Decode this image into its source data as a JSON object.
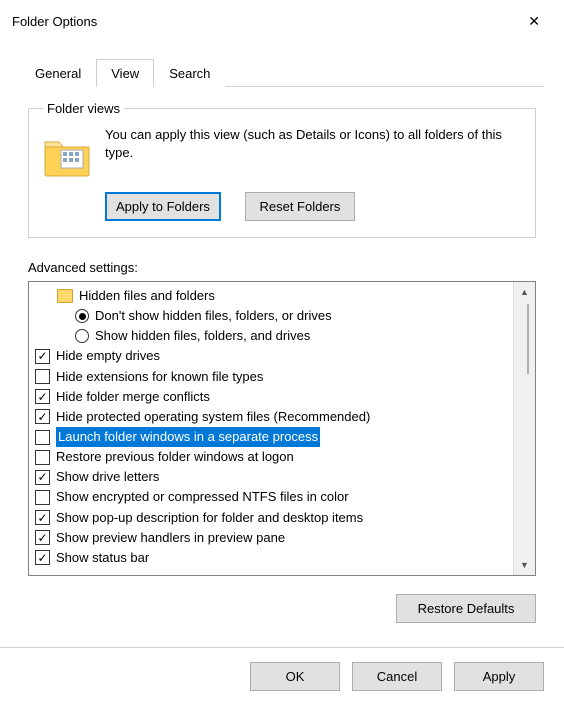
{
  "window_title": "Folder Options",
  "tabs": {
    "general": "General",
    "view": "View",
    "search": "Search"
  },
  "folder_views": {
    "legend": "Folder views",
    "text": "You can apply this view (such as Details or Icons) to all folders of this type.",
    "apply": "Apply to Folders",
    "reset": "Reset Folders"
  },
  "advanced": {
    "label": "Advanced settings:",
    "groupHeader": "Hidden files and folders",
    "radio1": "Don't show hidden files, folders, or drives",
    "radio2": "Show hidden files, folders, and drives",
    "items": [
      {
        "label": "Hide empty drives",
        "checked": true
      },
      {
        "label": "Hide extensions for known file types",
        "checked": false
      },
      {
        "label": "Hide folder merge conflicts",
        "checked": true
      },
      {
        "label": "Hide protected operating system files (Recommended)",
        "checked": true
      },
      {
        "label": "Launch folder windows in a separate process",
        "checked": false,
        "highlight": true
      },
      {
        "label": "Restore previous folder windows at logon",
        "checked": false
      },
      {
        "label": "Show drive letters",
        "checked": true
      },
      {
        "label": "Show encrypted or compressed NTFS files in color",
        "checked": false
      },
      {
        "label": "Show pop-up description for folder and desktop items",
        "checked": true
      },
      {
        "label": "Show preview handlers in preview pane",
        "checked": true
      },
      {
        "label": "Show status bar",
        "checked": true
      }
    ]
  },
  "restore_defaults": "Restore Defaults",
  "buttons": {
    "ok": "OK",
    "cancel": "Cancel",
    "apply": "Apply"
  }
}
